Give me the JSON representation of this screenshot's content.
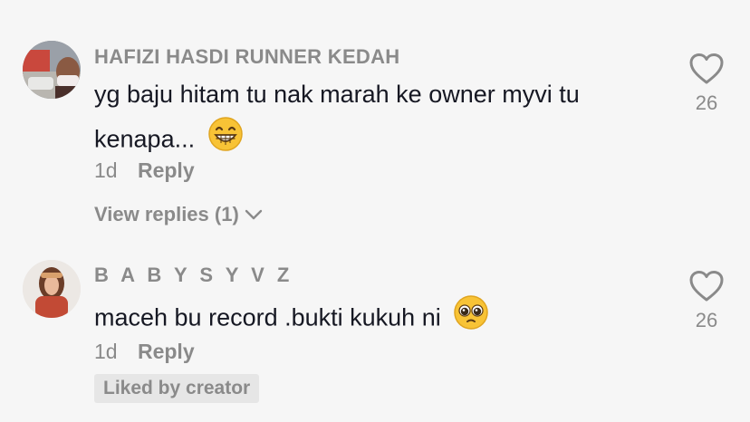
{
  "comments": [
    {
      "username": "HAFIZI HASDI RUNNER KEDAH",
      "text": "yg baju hitam tu nak marah ke owner myvi tu kenapa...",
      "emoji": "grinning-face",
      "time": "1d",
      "reply_label": "Reply",
      "view_replies": "View replies (1)",
      "likes": "26"
    },
    {
      "username": "B A B Y S Y V Z",
      "text": "maceh bu record .bukti kukuh ni",
      "emoji": "pleading-face",
      "time": "1d",
      "reply_label": "Reply",
      "badge": "Liked by creator",
      "likes": "26"
    }
  ],
  "icons": {
    "like": "heart-outline-icon",
    "expand": "chevron-down-icon"
  },
  "colors": {
    "muted": "#8a8a8a",
    "text": "#161823",
    "background": "#f6f6f6"
  }
}
